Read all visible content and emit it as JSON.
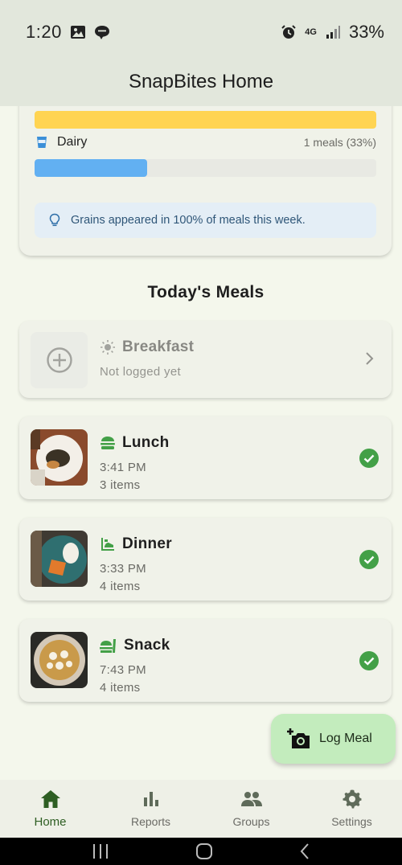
{
  "status_bar": {
    "time": "1:20",
    "network": "4G",
    "battery": "33%"
  },
  "app_bar": {
    "title": "SnapBites Home"
  },
  "summary": {
    "food_groups": [
      {
        "name": "",
        "count": "",
        "fraction": 1.0,
        "color": "#ffd452"
      },
      {
        "name": "Dairy",
        "count": "1 meals (33%)",
        "fraction": 0.33,
        "color": "#62b0f2",
        "icon": "cup-icon"
      }
    ],
    "insight": "Grains appeared in 100% of meals this week."
  },
  "todays_meals": {
    "title": "Today's Meals",
    "meals": [
      {
        "name": "Breakfast",
        "line1": "Not logged yet",
        "line2": "",
        "logged": false,
        "icon": "sun-icon"
      },
      {
        "name": "Lunch",
        "line1": "3:41 PM",
        "line2": "3 items",
        "logged": true,
        "icon": "burger-icon"
      },
      {
        "name": "Dinner",
        "line1": "3:33 PM",
        "line2": "4 items",
        "logged": true,
        "icon": "dinner-icon"
      },
      {
        "name": "Snack",
        "line1": "7:43 PM",
        "line2": "4 items",
        "logged": true,
        "icon": "snack-icon"
      }
    ]
  },
  "fab": {
    "label": "Log Meal"
  },
  "bottom_nav": {
    "items": [
      {
        "label": "Home",
        "icon": "home-icon",
        "active": true
      },
      {
        "label": "Reports",
        "icon": "bar-chart-icon",
        "active": false
      },
      {
        "label": "Groups",
        "icon": "people-icon",
        "active": false
      },
      {
        "label": "Settings",
        "icon": "gear-icon",
        "active": false
      }
    ]
  },
  "colors": {
    "accent_green": "#43a047",
    "nav_active": "#2e5e23",
    "fab_bg": "#c3ecbd"
  }
}
